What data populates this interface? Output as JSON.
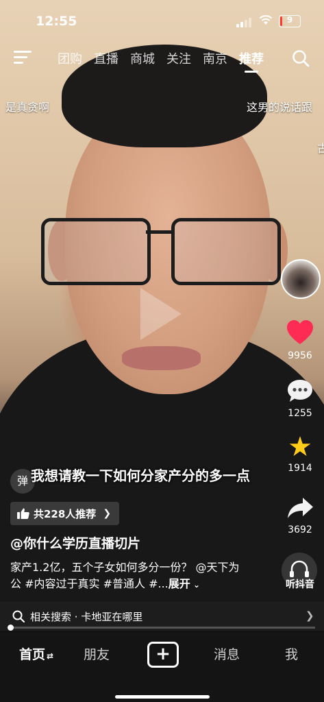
{
  "status_bar": {
    "time": "12:55",
    "battery": "9"
  },
  "top_nav": {
    "tabs": [
      "团购",
      "直播",
      "商城",
      "关注",
      "南京",
      "推荐"
    ],
    "active_tab": "推荐"
  },
  "danmaku": {
    "left": "是真贪啊",
    "right": "这男的说话跟",
    "edge": "古"
  },
  "subtitle": "我想请教一下如何分家产分的多一点",
  "danmaku_toggle_label": "弹",
  "actions": {
    "likes": "9956",
    "comments": "1255",
    "favorites": "1914",
    "shares": "3692",
    "listen_label": "听抖音"
  },
  "recommend_badge": "共228人推荐",
  "author": "@你什么学历直播切片",
  "description": "家产1.2亿，五个子女如何多分一份？ @天下为公 #内容过于真实 #普通人 #...",
  "expand_label": "展开",
  "related_search": {
    "prefix": "相关搜索",
    "separator": "·",
    "query": "卡地亚在哪里"
  },
  "progress": 0.0,
  "bottom_nav": {
    "home": "首页",
    "friends": "朋友",
    "messages": "消息",
    "me": "我"
  },
  "colors": {
    "like": "#fe2c55",
    "favorite": "#ffcc1a"
  }
}
